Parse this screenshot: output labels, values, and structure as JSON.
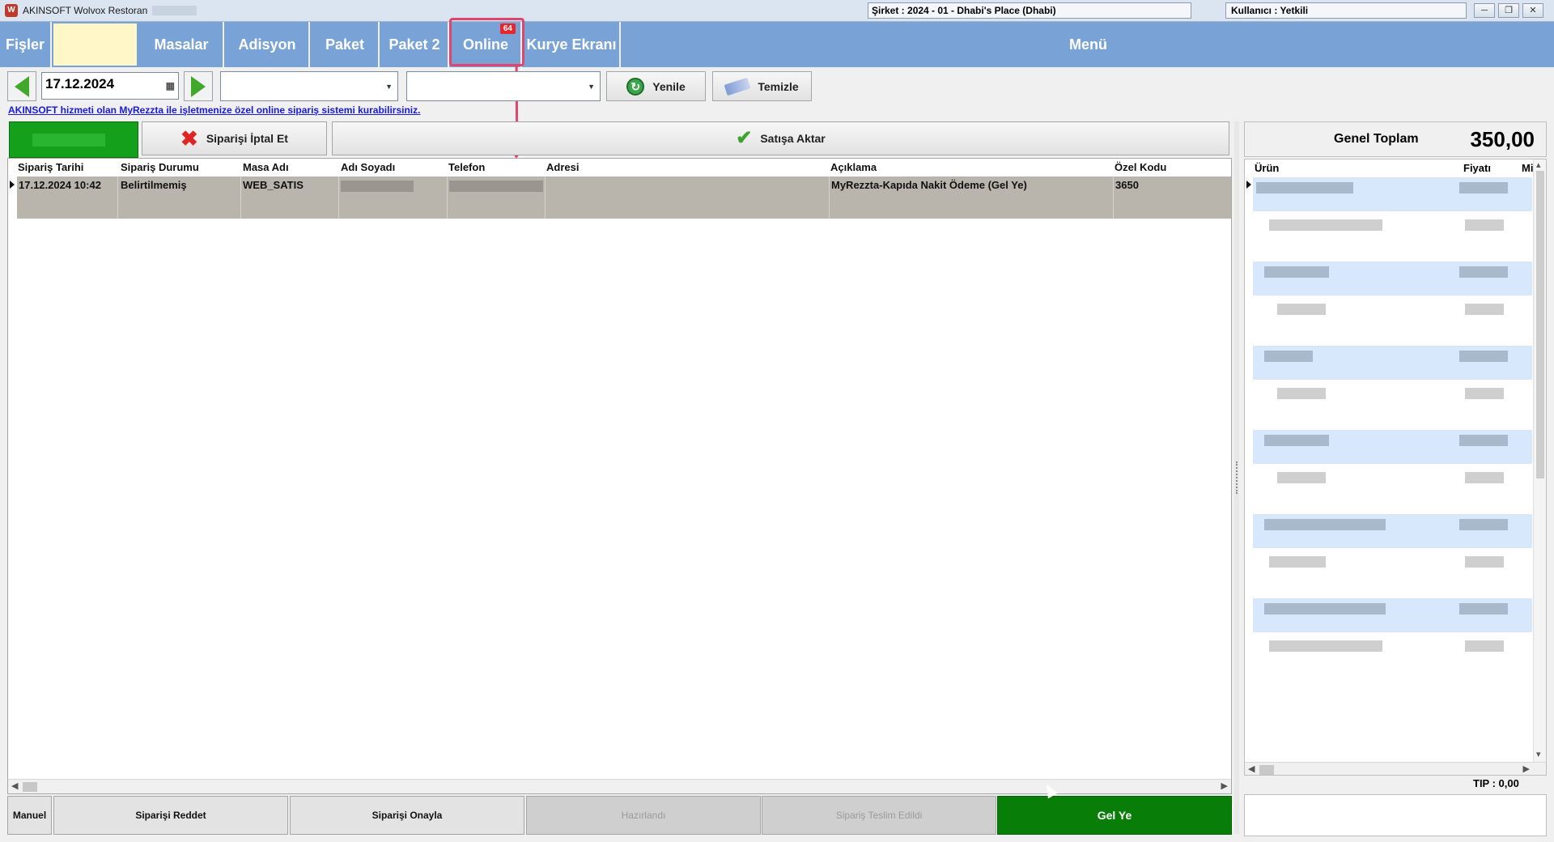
{
  "window": {
    "title": "AKINSOFT Wolvox Restoran",
    "company": "Şirket : 2024 - 01 - Dhabi's Place (Dhabi)",
    "user": "Kullanıcı : Yetkili",
    "controls": [
      "─",
      "❐",
      "✕"
    ]
  },
  "tabs": [
    {
      "label": "Fişler"
    },
    {
      "label": ""
    },
    {
      "label": "Masalar"
    },
    {
      "label": "Adisyon"
    },
    {
      "label": "Paket"
    },
    {
      "label": "Paket 2"
    },
    {
      "label": "Online",
      "badge": "64"
    },
    {
      "label": "Kurye Ekranı"
    },
    {
      "label": "Menü"
    }
  ],
  "filters": {
    "date": "17.12.2024",
    "combo1": "",
    "combo2": "",
    "refresh_label": "Yenile",
    "clear_label": "Temizle"
  },
  "promo_link": "AKINSOFT hizmeti olan MyRezzta ile işletmenize özel online sipariş sistemi kurabilirsiniz.",
  "actions": {
    "cancel_label": "Siparişi İptal Et",
    "transfer_label": "Satışa Aktar"
  },
  "orders": {
    "columns": [
      "Sipariş Tarihi",
      "Sipariş Durumu",
      "Masa Adı",
      "Adı Soyadı",
      "Telefon",
      "Adresi",
      "Açıklama",
      "Özel Kodu"
    ],
    "rows": [
      {
        "date": "17.12.2024 10:42",
        "status": "Belirtilmemiş",
        "table": "WEB_SATIS",
        "name": "",
        "phone": "",
        "address": "",
        "note": "MyRezzta-Kapıda Nakit Ödeme (Gel Ye)",
        "code": "3650"
      }
    ]
  },
  "summary": {
    "total_label": "Genel Toplam",
    "total_value": "350,00",
    "columns": [
      "Ürün",
      "Fiyatı",
      "Mi"
    ],
    "tip": "TIP : 0,00"
  },
  "bottom_buttons": {
    "manual": "Manuel",
    "reject": "Siparişi Reddet",
    "approve": "Siparişi Onayla",
    "prepared": "Hazırlandı",
    "delivered": "Sipariş Teslim Edildi",
    "gel_ye": "Gel Ye"
  },
  "colors": {
    "tab_blue": "#79a3d6",
    "highlight": "#e0456d",
    "green": "#087e08",
    "row_selected": "#b9b5ad"
  }
}
